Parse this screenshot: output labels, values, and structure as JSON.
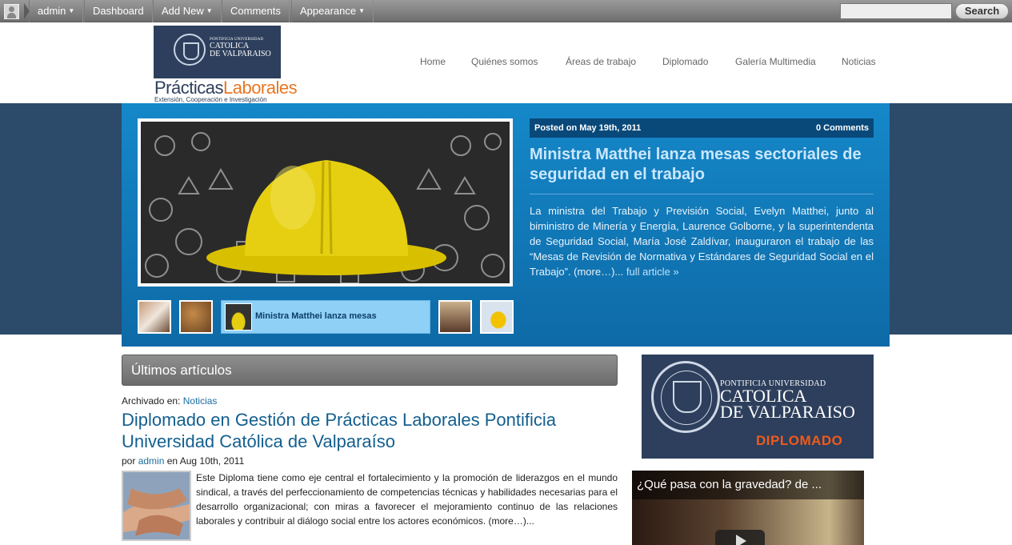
{
  "adminbar": {
    "items": [
      "admin",
      "Dashboard",
      "Add New",
      "Comments",
      "Appearance"
    ],
    "search_button": "Search",
    "search_placeholder": ""
  },
  "header": {
    "logo": {
      "uni_small": "PONTIFICIA UNIVERSIDAD",
      "uni_line1": "CATOLICA",
      "uni_line2": "DE VALPARAISO",
      "brand_a": "Prácticas",
      "brand_b": "Laborales",
      "tagline": "Extensión, Cooperación e Investigación"
    },
    "nav": [
      "Home",
      "Quiénes somos",
      "Áreas de trabajo",
      "Diplomado",
      "Galería Multimedia",
      "Noticias"
    ]
  },
  "featured": {
    "posted": "Posted on May 19th, 2011",
    "comments": "0 Comments",
    "title": "Ministra Matthei lanza mesas sectoriales de seguridad en el trabajo",
    "excerpt": "La ministra del Trabajo y Previsión Social, Evelyn Matthei, junto al biministro de Minería y Energía, Laurence Golborne, y la superintendenta de Seguridad Social, María José Zaldívar, inauguraron el trabajo de las “Mesas de Revisión de Normativa y Estándares de Seguridad Social en el Trabajo”. (more…)...",
    "full_article": "full article »",
    "active_thumb_label": "Ministra Matthei lanza mesas"
  },
  "content": {
    "section_title": "Últimos artículos",
    "archived_label": "Archivado en:",
    "archived_category": "Noticias",
    "article_title": "Diplomado en Gestión de Prácticas Laborales Pontificia Universidad Católica de Valparaíso",
    "by": "por",
    "author": "admin",
    "date": "en Aug 10th, 2011",
    "excerpt": "Este Diploma tiene como eje central el fortalecimiento y la promoción de liderazgos en el mundo sindical, a través del perfeccionamiento de competencias técnicas y habilidades necesarias para el desarrollo organizacional; con miras a favorecer el mejoramiento continuo de las relaciones laborales y contribuir al diálogo social entre los actores económicos. (more…)..."
  },
  "sidebar": {
    "ad": {
      "line1": "PONTIFICIA UNIVERSIDAD",
      "line2": "CATOLICA",
      "line3": "DE VALPARAISO",
      "line4": "DIPLOMADO"
    },
    "video_title": "¿Qué pasa con la gravedad? de ..."
  },
  "colors": {
    "hero_blue": "#1588c9",
    "band_navy": "#2c4a6a",
    "link_blue": "#135f8f",
    "accent_orange": "#e87722"
  }
}
